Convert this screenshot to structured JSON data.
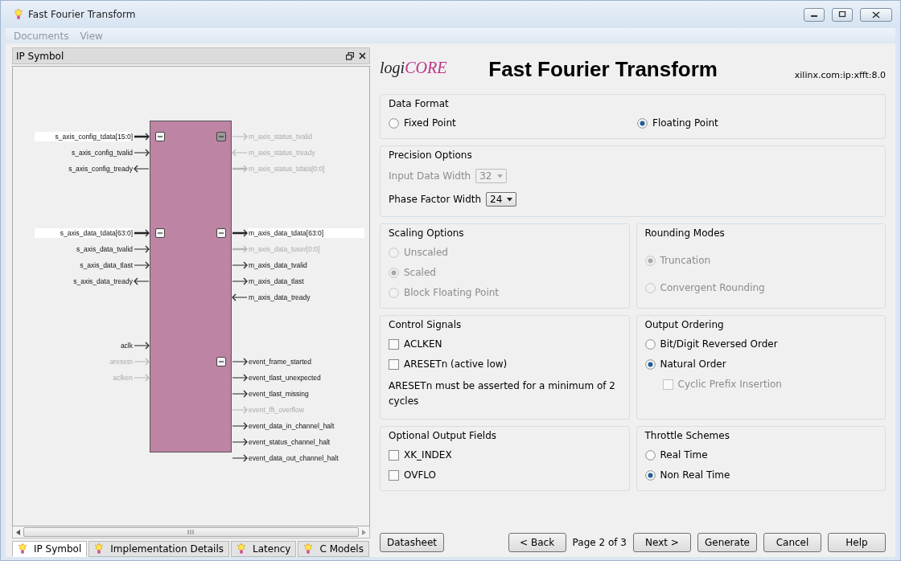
{
  "window": {
    "title": "Fast Fourier Transform"
  },
  "menu": [
    {
      "label": "Documents",
      "disabled": true
    },
    {
      "label": "View",
      "disabled": true
    }
  ],
  "left_panel": {
    "title": "IP Symbol",
    "symbol": {
      "left_groups": [
        {
          "kind": "bus-group",
          "pins": [
            {
              "name": "s_axis_config_tdata[15:0]",
              "output": false,
              "kind": "bus",
              "disabled": false,
              "highlighted": true
            },
            {
              "name": "s_axis_config_tvalid",
              "output": false,
              "kind": "single",
              "disabled": false,
              "highlighted": false
            },
            {
              "name": "s_axis_config_tready",
              "output": true,
              "kind": "single",
              "disabled": false,
              "highlighted": false
            }
          ]
        },
        {
          "kind": "bus-group",
          "pins": [
            {
              "name": "s_axis_data_tdata[63:0]",
              "output": false,
              "kind": "bus",
              "disabled": false,
              "highlighted": true
            },
            {
              "name": "s_axis_data_tvalid",
              "output": false,
              "kind": "single",
              "disabled": false,
              "highlighted": false
            },
            {
              "name": "s_axis_data_tlast",
              "output": false,
              "kind": "single",
              "disabled": false,
              "highlighted": false
            },
            {
              "name": "s_axis_data_tready",
              "output": true,
              "kind": "single",
              "disabled": false,
              "highlighted": false
            }
          ]
        },
        {
          "kind": "plain",
          "pins": [
            {
              "name": "aclk",
              "output": false,
              "kind": "single",
              "disabled": false,
              "highlighted": false
            },
            {
              "name": "aresetn",
              "output": false,
              "kind": "single",
              "disabled": true,
              "highlighted": false
            },
            {
              "name": "aclken",
              "output": false,
              "kind": "single",
              "disabled": true,
              "highlighted": false
            }
          ]
        }
      ],
      "right_groups": [
        {
          "kind": "bus-group",
          "disabled": true,
          "pins": [
            {
              "name": "m_axis_status_tvalid",
              "output": true,
              "kind": "single",
              "disabled": true,
              "highlighted": false
            },
            {
              "name": "m_axis_status_tready",
              "output": false,
              "kind": "single",
              "disabled": true,
              "highlighted": false
            },
            {
              "name": "m_axis_status_tdata[0:0]",
              "output": true,
              "kind": "bus",
              "disabled": true,
              "highlighted": false
            }
          ]
        },
        {
          "kind": "bus-group",
          "disabled": false,
          "pins": [
            {
              "name": "m_axis_data_tdata[63:0]",
              "output": true,
              "kind": "bus",
              "disabled": false,
              "highlighted": true
            },
            {
              "name": "m_axis_data_tuser[0:0]",
              "output": true,
              "kind": "bus",
              "disabled": true,
              "highlighted": false
            },
            {
              "name": "m_axis_data_tvalid",
              "output": true,
              "kind": "single",
              "disabled": false,
              "highlighted": false
            },
            {
              "name": "m_axis_data_tlast",
              "output": true,
              "kind": "single",
              "disabled": false,
              "highlighted": false
            },
            {
              "name": "m_axis_data_tready",
              "output": false,
              "kind": "single",
              "disabled": false,
              "highlighted": false
            }
          ]
        },
        {
          "kind": "bus-group",
          "disabled": false,
          "pins": [
            {
              "name": "event_frame_started",
              "output": true,
              "kind": "single",
              "disabled": false,
              "highlighted": false
            },
            {
              "name": "event_tlast_unexpected",
              "output": true,
              "kind": "single",
              "disabled": false,
              "highlighted": false
            },
            {
              "name": "event_tlast_missing",
              "output": true,
              "kind": "single",
              "disabled": false,
              "highlighted": false
            },
            {
              "name": "event_fft_overflow",
              "output": true,
              "kind": "single",
              "disabled": true,
              "highlighted": false
            },
            {
              "name": "event_data_in_channel_halt",
              "output": true,
              "kind": "single",
              "disabled": false,
              "highlighted": false
            },
            {
              "name": "event_status_channel_halt",
              "output": true,
              "kind": "single",
              "disabled": false,
              "highlighted": false
            },
            {
              "name": "event_data_out_channel_halt",
              "output": true,
              "kind": "single",
              "disabled": false,
              "highlighted": false
            }
          ]
        }
      ]
    },
    "tabs": [
      {
        "label": "IP Symbol",
        "selected": true
      },
      {
        "label": "Implementation Details",
        "selected": false
      },
      {
        "label": "Latency",
        "selected": false
      },
      {
        "label": "C Models",
        "selected": false
      }
    ]
  },
  "header": {
    "logo_text": "logi",
    "logo_accent": "CORE",
    "title": "Fast Fourier Transform",
    "version": "xilinx.com:ip:xfft:8.0"
  },
  "sections": [
    {
      "title": "Data Format",
      "kind": "inline",
      "items": [
        {
          "kind": "radio",
          "label": "Fixed Point",
          "selected": false,
          "disabled": false
        },
        {
          "kind": "radio",
          "label": "Floating Point",
          "selected": true,
          "disabled": false
        }
      ]
    },
    {
      "title": "Precision Options",
      "kind": "stack",
      "items": [
        {
          "kind": "select",
          "label": "Input Data Width",
          "value": "32",
          "disabled": true
        },
        {
          "kind": "select",
          "label": "Phase Factor Width",
          "value": "24",
          "disabled": false
        }
      ]
    },
    {
      "title": "Scaling Options",
      "kind": "half",
      "items": [
        {
          "kind": "radio",
          "label": "Unscaled",
          "selected": false,
          "disabled": true
        },
        {
          "kind": "radio",
          "label": "Scaled",
          "selected": true,
          "disabled": true
        },
        {
          "kind": "radio",
          "label": "Block Floating Point",
          "selected": false,
          "disabled": true
        }
      ]
    },
    {
      "title": "Rounding Modes",
      "kind": "half-spread",
      "items": [
        {
          "kind": "radio",
          "label": "Truncation",
          "selected": true,
          "disabled": true
        },
        {
          "kind": "radio",
          "label": "Convergent Rounding",
          "selected": false,
          "disabled": true
        }
      ]
    },
    {
      "title": "Control Signals",
      "kind": "half",
      "items": [
        {
          "kind": "checkbox",
          "label": "ACLKEN",
          "checked": false,
          "disabled": false
        },
        {
          "kind": "checkbox",
          "label": "ARESETn (active low)",
          "checked": false,
          "disabled": false
        },
        {
          "kind": "note",
          "label": "ARESETn must be asserted for a minimum of 2 cycles"
        }
      ]
    },
    {
      "title": "Output Ordering",
      "kind": "half",
      "items": [
        {
          "kind": "radio",
          "label": "Bit/Digit Reversed Order",
          "selected": false,
          "disabled": false
        },
        {
          "kind": "radio",
          "label": "Natural Order",
          "selected": true,
          "disabled": false
        },
        {
          "kind": "sub-checkbox",
          "label": "Cyclic Prefix Insertion",
          "checked": false,
          "disabled": true
        }
      ]
    },
    {
      "title": "Optional Output Fields",
      "kind": "half",
      "items": [
        {
          "kind": "checkbox",
          "label": "XK_INDEX",
          "checked": false,
          "disabled": false
        },
        {
          "kind": "checkbox",
          "label": "OVFLO",
          "checked": false,
          "disabled": false
        }
      ]
    },
    {
      "title": "Throttle Schemes",
      "kind": "half",
      "items": [
        {
          "kind": "radio",
          "label": "Real Time",
          "selected": false,
          "disabled": false
        },
        {
          "kind": "radio",
          "label": "Non Real Time",
          "selected": true,
          "disabled": false
        }
      ]
    }
  ],
  "footer": {
    "left_button": "Datasheet",
    "back": "< Back",
    "page": "Page 2 of 3",
    "buttons": [
      "Next >",
      "Generate",
      "Cancel",
      "Help"
    ]
  }
}
